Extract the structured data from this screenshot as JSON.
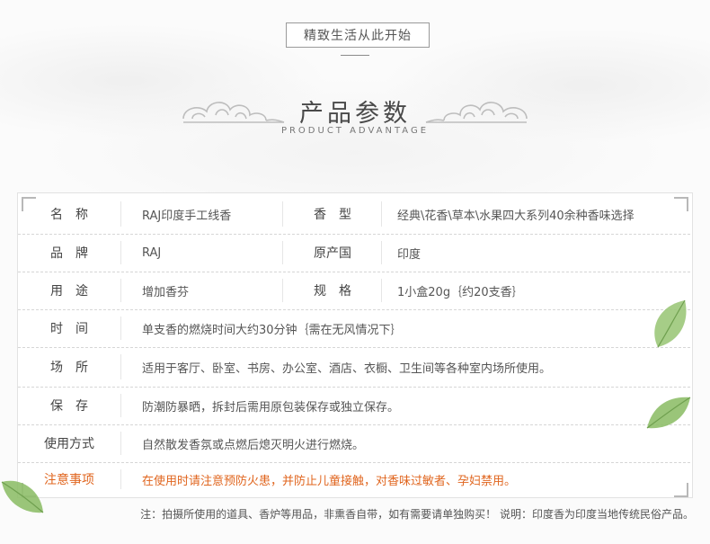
{
  "header": {
    "slogan": "精致生活从此开始",
    "title": "产品参数",
    "subtitle": "PRODUCT ADVANTAGE"
  },
  "params": {
    "rows": [
      {
        "label": "名　称",
        "value": "RAJ印度手工线香",
        "label2": "香　型",
        "value2": "经典\\花香\\草本\\水果四大系列40余种香味选择"
      },
      {
        "label": "品　牌",
        "value": "RAJ",
        "label2": "原产国",
        "value2": "印度"
      },
      {
        "label": "用　途",
        "value": "增加香芬",
        "label2": "规　格",
        "value2": "1小盒20g｛约20支香｝"
      },
      {
        "label": "时　间",
        "value": "单支香的燃烧时间大约30分钟｛需在无风情况下｝"
      },
      {
        "label": "场　所",
        "value": "适用于客厅、卧室、书房、办公室、酒店、衣橱、卫生间等各种室内场所使用。"
      },
      {
        "label": "保　存",
        "value": "防潮防暴晒，拆封后需用原包装保存或独立保存。"
      },
      {
        "label": "使用方式",
        "value": "自然散发香氛或点燃后熄灭明火进行燃烧。"
      },
      {
        "label": "注意事项",
        "value": "在使用时请注意预防火患，并防止儿童接触，对香味过敏者、孕妇禁用。"
      }
    ]
  },
  "footnote": "注：拍摄所使用的道具、香炉等用品，非熏香自带，如有需要请单独购买！  说明：印度香为印度当地传统民俗产品。",
  "colors": {
    "warning": "#e0651e",
    "leaf": "#8fbf6a"
  }
}
